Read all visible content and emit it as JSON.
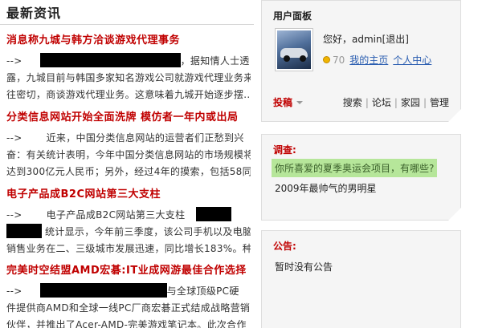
{
  "left": {
    "section_title": "最新资讯",
    "news": [
      {
        "title": "消息称九城与韩方洽谈游戏代理事务",
        "lines": [
          {
            "prefix": "-->",
            "redact": true,
            "text": "，据知情人士透"
          },
          {
            "text": "露，九城目前与韩国多家知名游戏公司就游戏代理业务来"
          },
          {
            "text": "往密切，商谈游戏代理业务。这意味着九城开始逐步摆..."
          }
        ]
      },
      {
        "title": "分类信息网站开始全面洗牌 模仿者一年内或出局",
        "lines": [
          {
            "prefix": "-->",
            "text": "近来，中国分类信息网站的运营者们正愁到兴"
          },
          {
            "text": "奋：有关统计表明，今年中国分类信息网站的市场规模将"
          },
          {
            "text": "达到300亿元人民币；另外，经过4年的摸索，包括58同"
          }
        ]
      },
      {
        "title": "电子产品成B2C网站第三大支柱",
        "lines": [
          {
            "prefix": "-->",
            "text": "电子产品成B2C网站第三大支柱"
          },
          {
            "text": "统计显示，今年前三季度，该公司手机以及电脑"
          },
          {
            "text": "销售业务在二、三级城市发展迅速，同比增长183%。种"
          }
        ]
      },
      {
        "title": "完美时空结盟AMD宏碁:IT业成网游最佳合作选择",
        "lines": [
          {
            "prefix": "-->",
            "redact": true,
            "text": "与全球顶级PC硬"
          },
          {
            "text": "件提供商AMD和全球一线PC厂商宏碁正式结成战略营销"
          },
          {
            "text": "伙伴，并推出了Acer-AMD-完美游戏笔记本。此次合作"
          }
        ]
      }
    ]
  },
  "user_panel": {
    "title": "用户面板",
    "greeting_prefix": "您好，",
    "username": "admin",
    "logout": "[退出]",
    "credits": "70",
    "my_home": "我的主页",
    "personal_center": "个人中心",
    "post_label": "投稿",
    "quick_links": [
      "搜索",
      "论坛",
      "家园",
      "管理"
    ],
    "separator": "|"
  },
  "poll_panel": {
    "title": "调查:",
    "question": "你所喜爱的夏季奥运会项目，有哪些?",
    "option": "2009年最帅气的男明星"
  },
  "notice_panel": {
    "title": "公告:",
    "text": "暂时没有公告"
  }
}
